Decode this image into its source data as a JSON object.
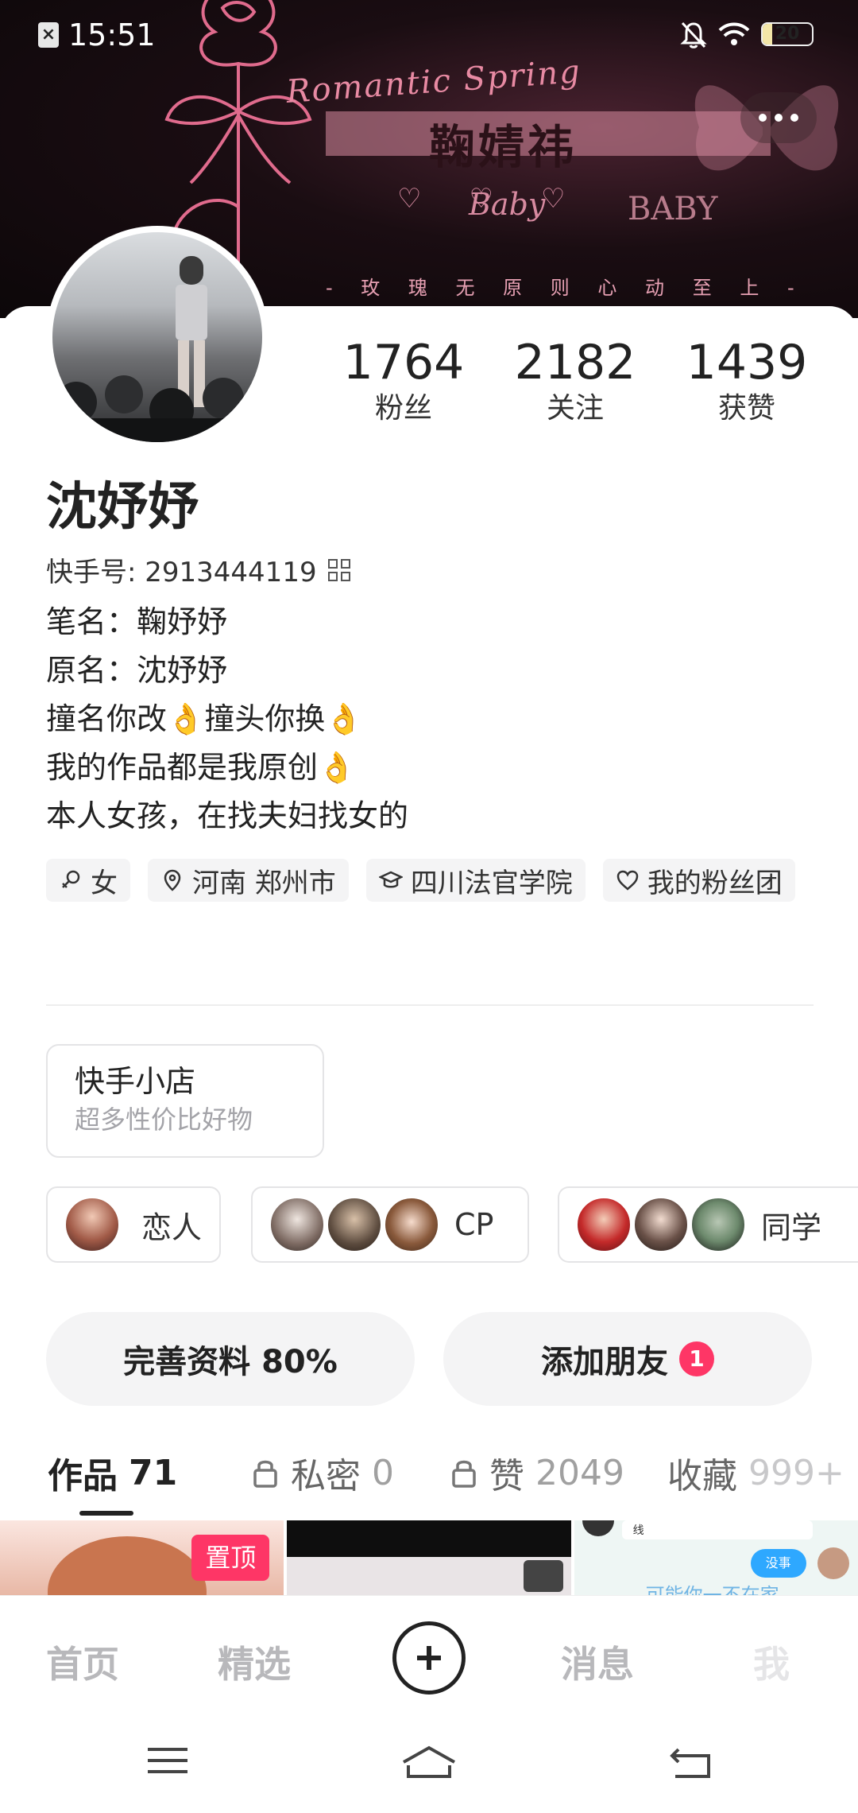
{
  "status_bar": {
    "time": "15:51",
    "battery": "20",
    "battery_level": 0.2
  },
  "banner": {
    "script_text": "Romantic Spring",
    "art_name": "鞠婧祎",
    "baby_left": "Baby",
    "baby_right": "BABY",
    "slogan": "- 玫 瑰 无 原 则   心 动 至 上 -"
  },
  "profile": {
    "nickname": "沈妤妤",
    "kwai_id": "快手号: 2913444119",
    "stats": [
      {
        "value": "1764",
        "label": "粉丝"
      },
      {
        "value": "2182",
        "label": "关注"
      },
      {
        "value": "1439",
        "label": "获赞"
      }
    ],
    "bio": [
      "笔名：鞠妤妤",
      "原名：沈妤妤",
      "撞名你改👌撞头你换👌",
      "我的作品都是我原创👌",
      "本人女孩，在找夫妇找女的"
    ],
    "tags": {
      "gender": "女",
      "location": "河南 郑州市",
      "school": "四川法官学院",
      "fan_group": "我的粉丝团"
    }
  },
  "shop": {
    "title": "快手小店",
    "subtitle": "超多性价比好物"
  },
  "relations": [
    {
      "label": "恋人"
    },
    {
      "label": "CP"
    },
    {
      "label": "同学"
    }
  ],
  "actions": {
    "complete_profile": "完善资料 80%",
    "add_friend": "添加朋友",
    "add_friend_badge": "1"
  },
  "tabs": [
    {
      "label": "作品",
      "count": "71"
    },
    {
      "label": "私密",
      "count": "0"
    },
    {
      "label": "赞",
      "count": "2049"
    },
    {
      "label": "收藏",
      "count": "999+"
    }
  ],
  "thumbs": {
    "pin_label": "置顶",
    "chat_line": "线",
    "chat_reply": "没事",
    "chat_caption": "可能你一不在家"
  },
  "bottom_nav": [
    "首页",
    "精选",
    "消息",
    "我"
  ],
  "colors": {
    "accent": "#fe3666",
    "text": "#222222",
    "muted": "#a3a3a8",
    "chip_bg": "#f4f4f5"
  }
}
